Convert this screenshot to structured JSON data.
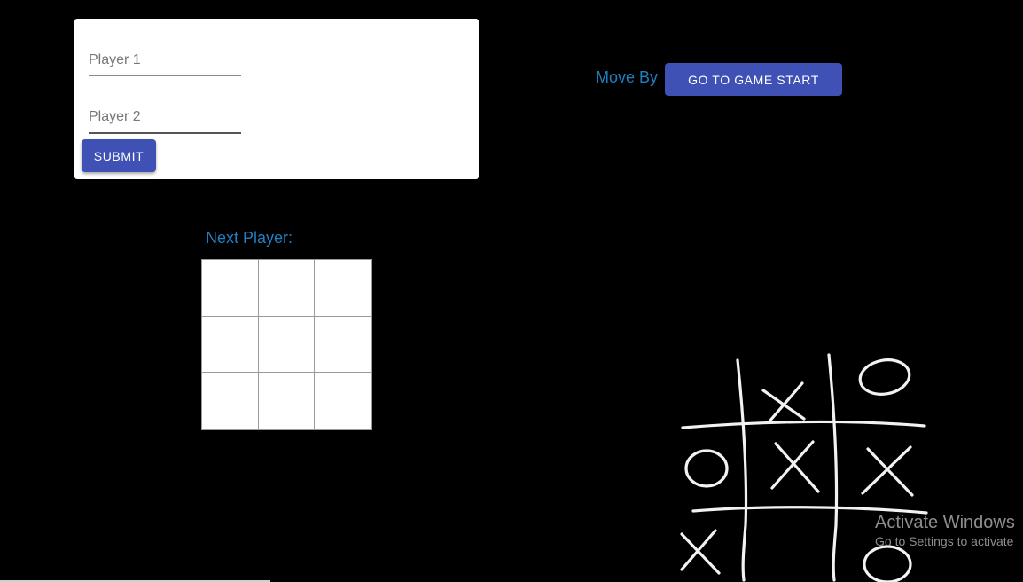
{
  "form": {
    "player1_placeholder": "Player 1",
    "player1_value": "",
    "player2_placeholder": "Player 2",
    "player2_value": "",
    "submit_label": "SUBMIT"
  },
  "history": {
    "move_by_label": "Move By",
    "go_to_start_label": "GO TO GAME START"
  },
  "game": {
    "next_player_label": "Next Player:",
    "board": [
      "",
      "",
      "",
      "",
      "",
      "",
      "",
      "",
      ""
    ]
  },
  "decoration": {
    "chalk_board_marks": [
      "",
      "X",
      "O",
      "O",
      "X",
      "X",
      "X",
      "",
      "O"
    ]
  },
  "watermark": {
    "title": "Activate Windows",
    "subtitle": "Go to Settings to activate"
  },
  "colors": {
    "background": "#000000",
    "accent": "#3f51b5",
    "label_blue": "#1f7fc1",
    "card": "#ffffff"
  }
}
